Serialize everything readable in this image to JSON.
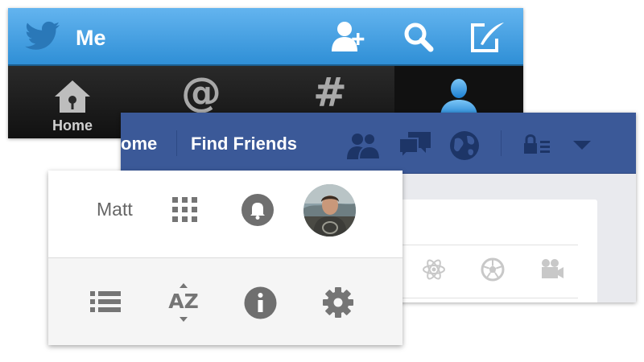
{
  "twitter": {
    "title": "Me",
    "actions": [
      "add-user-icon",
      "search-icon",
      "compose-icon"
    ],
    "tabs": [
      {
        "label": "Home",
        "icon": "house-icon",
        "active": false
      },
      {
        "label": "",
        "icon": "at-icon",
        "glyph": "@",
        "active": false
      },
      {
        "label": "",
        "icon": "hash-icon",
        "glyph": "#",
        "active": false
      },
      {
        "label": "",
        "icon": "person-icon",
        "active": true
      }
    ],
    "colors": {
      "bar": "#3a9be0",
      "tabbar": "#1a1a1a",
      "active_icon": "#2e9ae6"
    }
  },
  "facebook": {
    "home_label": "ome",
    "find_friends_label": "Find Friends",
    "icons": [
      "friends-icon",
      "messages-icon",
      "globe-icon",
      "privacy-icon",
      "dropdown-arrow-icon"
    ],
    "content_icons": [
      "atom-icon",
      "soccer-ball-icon",
      "video-camera-icon"
    ],
    "colors": {
      "bar": "#3b5998",
      "icon": "#1d3567"
    }
  },
  "google": {
    "user_name": "Matt",
    "top_icons": [
      "apps-grid-icon",
      "notifications-bell-icon",
      "avatar"
    ],
    "bottom_icons": [
      "list-icon",
      "sort-az-icon",
      "info-icon",
      "settings-gear-icon"
    ],
    "sort_text": "AZ",
    "colors": {
      "icon": "#757575"
    }
  }
}
